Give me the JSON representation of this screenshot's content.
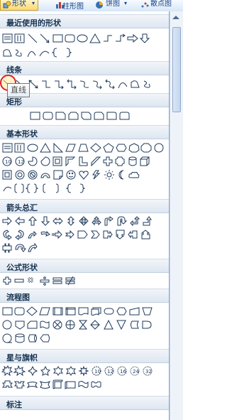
{
  "ribbon": {
    "shapes_label": "形状",
    "shapes_arrow": "▾",
    "chart_label": "柱形图",
    "pie_label": "饼图",
    "scatter_label": "散点图"
  },
  "sections": [
    {
      "title": "最近使用的形状"
    },
    {
      "title": "线条"
    },
    {
      "title": "矩形"
    },
    {
      "title": "基本形状"
    },
    {
      "title": "箭头总汇"
    },
    {
      "title": "公式形状"
    },
    {
      "title": "流程图"
    },
    {
      "title": "星与旗帜"
    },
    {
      "title": "标注"
    }
  ],
  "tooltip": {
    "text": "直线"
  },
  "colors": {
    "section_bg": "#dde6f1",
    "hover_ring": "#dd2222",
    "shape_stroke": "#1e395b"
  }
}
